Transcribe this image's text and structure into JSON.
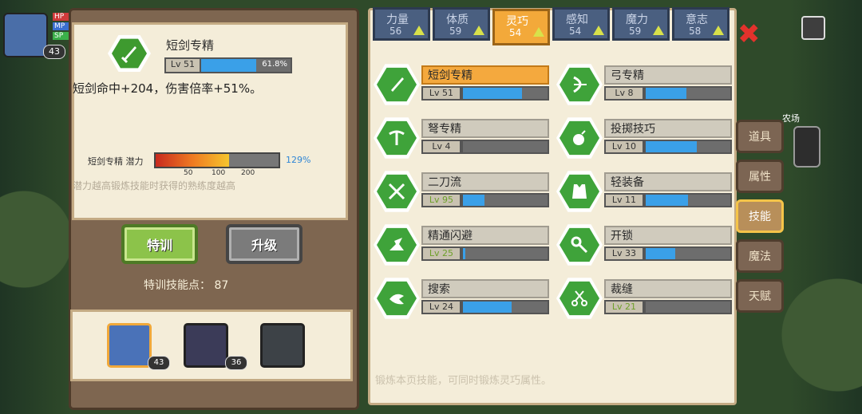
{
  "player": {
    "level": "43",
    "stats": [
      "HP",
      "MP",
      "SP"
    ]
  },
  "skill_detail": {
    "name": "短剑专精",
    "level": "Lv 51",
    "progress_percent": "61.8%",
    "progress": 0.618,
    "description": "短剑命中+204，伤害倍率+51%。",
    "potential_label": "短剑专精 潜力",
    "potential_ticks": [
      "50",
      "100",
      "200"
    ],
    "potential_value": "129%",
    "potential_fill": 0.6,
    "hint": "潜力越高锻炼技能时获得的熟练度越高"
  },
  "buttons": {
    "train": "特训",
    "upgrade": "升级"
  },
  "training_points": "特训技能点： 87",
  "team": [
    {
      "level": "43"
    },
    {
      "level": "36"
    }
  ],
  "attr_tabs": [
    {
      "name": "力量",
      "value": "56"
    },
    {
      "name": "体质",
      "value": "59"
    },
    {
      "name": "灵巧",
      "value": "54"
    },
    {
      "name": "感知",
      "value": "54"
    },
    {
      "name": "魔力",
      "value": "59"
    },
    {
      "name": "意志",
      "value": "58"
    }
  ],
  "skills": [
    {
      "name": "短剑专精",
      "level": "Lv 51",
      "progress": 0.7,
      "icon": "dagger-icon"
    },
    {
      "name": "弓专精",
      "level": "Lv 8",
      "progress": 0.48,
      "icon": "bow-icon"
    },
    {
      "name": "弩专精",
      "level": "Lv 4",
      "progress": 0.0,
      "icon": "crossbow-icon"
    },
    {
      "name": "投掷技巧",
      "level": "Lv 10",
      "progress": 0.6,
      "icon": "bomb-icon"
    },
    {
      "name": "二刀流",
      "level": "Lv 95",
      "progress": 0.25,
      "icon": "dual-swords-icon"
    },
    {
      "name": "轻装备",
      "level": "Lv 11",
      "progress": 0.5,
      "icon": "vest-icon"
    },
    {
      "name": "精通闪避",
      "level": "Lv 25",
      "progress": 0.03,
      "icon": "dodge-icon"
    },
    {
      "name": "开锁",
      "level": "Lv 33",
      "progress": 0.35,
      "icon": "key-icon"
    },
    {
      "name": "搜索",
      "level": "Lv 24",
      "progress": 0.58,
      "icon": "search-icon"
    },
    {
      "name": "裁缝",
      "level": "Lv 21",
      "progress": 0.0,
      "icon": "scissors-icon"
    }
  ],
  "footer_hint": "锻炼本页技能，可同时锻炼灵巧属性。",
  "side_tabs": [
    "道具",
    "属性",
    "技能",
    "魔法",
    "天赋"
  ],
  "map_label": "农场"
}
